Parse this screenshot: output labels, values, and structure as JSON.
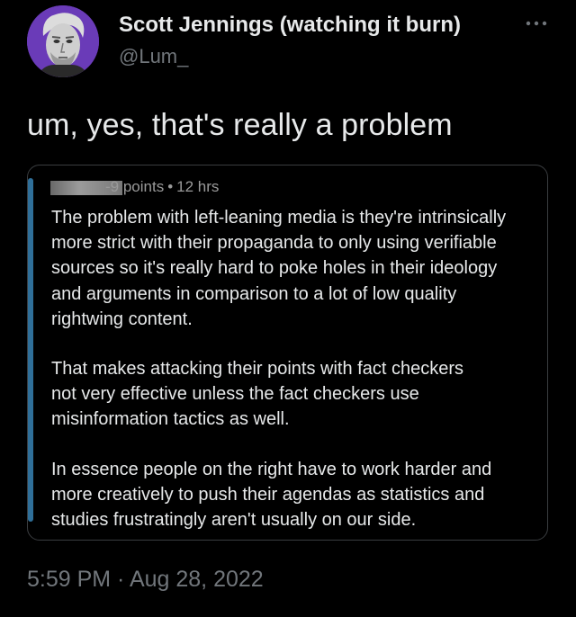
{
  "author": {
    "display_name": "Scott Jennings (watching it burn)",
    "handle": "@Lum_"
  },
  "tweet": {
    "text": "um, yes, that's really a problem",
    "timestamp": "5:59 PM · Aug 28, 2022"
  },
  "quoted_comment": {
    "points": "-9 points",
    "separator": "•",
    "age": "12 hrs",
    "paragraphs": [
      {
        "lines": [
          "The problem with left-leaning media is they're intrinsically",
          "more strict with their propaganda to only using verifiable",
          "sources so it's really hard to poke holes in their ideology",
          "and arguments in comparison to a lot of low quality",
          "rightwing content."
        ]
      },
      {
        "lines": [
          "That makes attacking their points with fact checkers",
          "not very effective unless the fact checkers use",
          "misinformation tactics as well."
        ]
      },
      {
        "lines": [
          "In essence people on the right have to work harder and",
          "more creatively to push their agendas as statistics and",
          "studies frustratingly aren't usually on our side."
        ]
      }
    ]
  },
  "icons": {
    "avatar": "avatar-portrait",
    "more": "more-dots-icon"
  },
  "colors": {
    "background": "#000000",
    "primary_text": "#e7e9ea",
    "secondary_text": "#71767b",
    "avatar_bg": "#6a3bb8",
    "comment_bar": "#2f6f99",
    "card_border": "#3a3d40"
  }
}
